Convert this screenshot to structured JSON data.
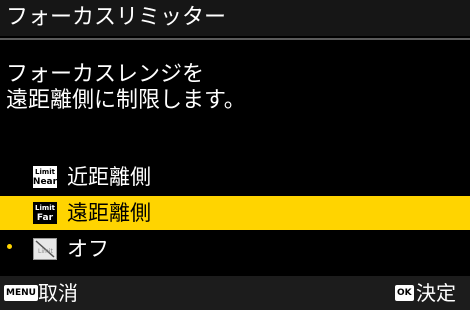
{
  "title": "フォーカスリミッター",
  "description": [
    "フォーカスレンジを",
    "遠距離側に制限します。"
  ],
  "menu": [
    {
      "icon_top": "Limit",
      "icon_bottom": "Near",
      "label": "近距離側",
      "selected": false,
      "current": false
    },
    {
      "icon_top": "Limit",
      "icon_bottom": "Far",
      "label": "遠距離側",
      "selected": true,
      "current": false
    },
    {
      "icon_top": "Limit",
      "icon_bottom": "",
      "label": "オフ",
      "selected": false,
      "current": true
    }
  ],
  "footer": {
    "menu_key": "MENU",
    "cancel_label": "取消",
    "ok_key": "OK",
    "confirm_label": "決定"
  },
  "colors": {
    "highlight": "#ffd400",
    "background": "#000000"
  }
}
